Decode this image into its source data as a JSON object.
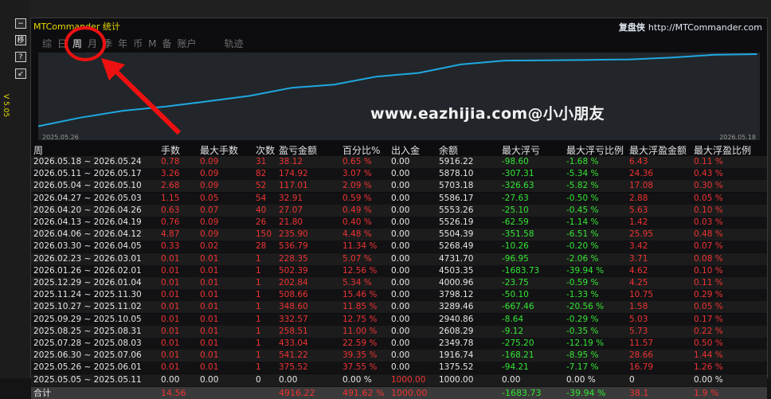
{
  "side": {
    "buttons": [
      "−",
      "移",
      "?",
      "↙"
    ],
    "version": "V 5.05"
  },
  "header": {
    "title": "MTCommander 统计",
    "brand_cn": "复盘侠",
    "brand_url": "http://MTCommander.com",
    "tabs": [
      {
        "label": "综",
        "active": false
      },
      {
        "label": "日",
        "active": false
      },
      {
        "label": "周",
        "active": true
      },
      {
        "label": "月",
        "active": false
      },
      {
        "label": "季",
        "active": false
      },
      {
        "label": "年",
        "active": false
      },
      {
        "label": "币",
        "active": false
      },
      {
        "label": "M",
        "active": false
      },
      {
        "label": "备",
        "active": false
      },
      {
        "label": "账户",
        "active": false
      },
      {
        "label": "轨迹",
        "active": false
      }
    ]
  },
  "chart": {
    "start_date": "2025.05.26",
    "end_date": "2026.05.18",
    "line_color": "#1fa8e0",
    "balance_series": [
      1375.52,
      1916.74,
      2349.78,
      2608.29,
      2940.86,
      3289.46,
      3798.12,
      4000.96,
      4503.35,
      4731.7,
      5268.49,
      5504.39,
      5526.19,
      5553.26,
      5586.17,
      5703.18,
      5878.1,
      5916.22
    ]
  },
  "watermark": "www.eazhijia.com@小小朋友",
  "table": {
    "headers": [
      "周",
      "手数",
      "最大手数",
      "次数",
      "盈亏金额",
      "百分比%",
      "出入金",
      "余额",
      "最大浮亏",
      "最大浮亏比例",
      "最大浮盈金额",
      "最大浮盈比例"
    ],
    "rows": [
      [
        "2026.05.18 ~ 2026.05.24",
        "0.78",
        "0.09",
        "31",
        "38.12",
        "0.65 %",
        "0.00",
        "5916.22",
        "-98.60",
        "-1.68 %",
        "6.43",
        "0.11 %"
      ],
      [
        "2026.05.11 ~ 2026.05.17",
        "3.26",
        "0.09",
        "82",
        "174.92",
        "3.07 %",
        "0.00",
        "5878.10",
        "-307.31",
        "-5.34 %",
        "24.36",
        "0.43 %"
      ],
      [
        "2026.05.04 ~ 2026.05.10",
        "2.68",
        "0.09",
        "52",
        "117.01",
        "2.09 %",
        "0.00",
        "5703.18",
        "-326.63",
        "-5.82 %",
        "17.08",
        "0.30 %"
      ],
      [
        "2026.04.27 ~ 2026.05.03",
        "1.15",
        "0.05",
        "54",
        "32.91",
        "0.59 %",
        "0.00",
        "5586.17",
        "-27.63",
        "-0.50 %",
        "2.88",
        "0.05 %"
      ],
      [
        "2026.04.20 ~ 2026.04.26",
        "0.63",
        "0.07",
        "40",
        "27.07",
        "0.49 %",
        "0.00",
        "5553.26",
        "-25.10",
        "-0.45 %",
        "5.63",
        "0.10 %"
      ],
      [
        "2026.04.13 ~ 2026.04.19",
        "0.76",
        "0.09",
        "26",
        "21.80",
        "0.40 %",
        "0.00",
        "5526.19",
        "-62.59",
        "-1.14 %",
        "1.42",
        "0.03 %"
      ],
      [
        "2026.04.06 ~ 2026.04.12",
        "4.87",
        "0.09",
        "150",
        "235.90",
        "4.48 %",
        "0.00",
        "5504.39",
        "-351.58",
        "-6.51 %",
        "25.95",
        "0.48 %"
      ],
      [
        "2026.03.30 ~ 2026.04.05",
        "0.33",
        "0.02",
        "28",
        "536.79",
        "11.34 %",
        "0.00",
        "5268.49",
        "-10.26",
        "-0.20 %",
        "3.42",
        "0.07 %"
      ],
      [
        "2026.02.23 ~ 2026.03.01",
        "0.01",
        "0.01",
        "1",
        "228.35",
        "5.07 %",
        "0.00",
        "4731.70",
        "-96.95",
        "-2.06 %",
        "3.71",
        "0.08 %"
      ],
      [
        "2026.01.26 ~ 2026.02.01",
        "0.01",
        "0.01",
        "1",
        "502.39",
        "12.56 %",
        "0.00",
        "4503.35",
        "-1683.73",
        "-39.94 %",
        "4.62",
        "0.10 %"
      ],
      [
        "2025.12.29 ~ 2026.01.04",
        "0.01",
        "0.01",
        "1",
        "202.84",
        "5.34 %",
        "0.00",
        "4000.96",
        "-23.75",
        "-0.59 %",
        "4.25",
        "0.11 %"
      ],
      [
        "2025.11.24 ~ 2025.11.30",
        "0.01",
        "0.01",
        "1",
        "508.66",
        "15.46 %",
        "0.00",
        "3798.12",
        "-50.10",
        "-1.33 %",
        "10.75",
        "0.29 %"
      ],
      [
        "2025.10.27 ~ 2025.11.02",
        "0.01",
        "0.01",
        "1",
        "348.60",
        "11.85 %",
        "0.00",
        "3289.46",
        "-667.46",
        "-20.56 %",
        "1.58",
        "0.05 %"
      ],
      [
        "2025.09.29 ~ 2025.10.05",
        "0.01",
        "0.01",
        "1",
        "332.57",
        "12.75 %",
        "0.00",
        "2940.86",
        "-8.64",
        "-0.29 %",
        "5.03",
        "0.17 %"
      ],
      [
        "2025.08.25 ~ 2025.08.31",
        "0.01",
        "0.01",
        "1",
        "258.51",
        "11.00 %",
        "0.00",
        "2608.29",
        "-9.12",
        "-0.35 %",
        "5.73",
        "0.22 %"
      ],
      [
        "2025.07.28 ~ 2025.08.03",
        "0.01",
        "0.01",
        "1",
        "433.04",
        "22.59 %",
        "0.00",
        "2349.78",
        "-275.20",
        "-12.19 %",
        "11.57",
        "0.50 %"
      ],
      [
        "2025.06.30 ~ 2025.07.06",
        "0.01",
        "0.01",
        "1",
        "541.22",
        "39.35 %",
        "0.00",
        "1916.74",
        "-168.21",
        "-8.95 %",
        "28.66",
        "1.44 %"
      ],
      [
        "2025.05.26 ~ 2025.06.01",
        "0.01",
        "0.01",
        "1",
        "375.52",
        "37.55 %",
        "0.00",
        "1375.52",
        "-94.21",
        "-7.17 %",
        "16.79",
        "1.26 %"
      ],
      [
        "2025.05.05 ~ 2025.05.11",
        "0.00",
        "0.00",
        "0",
        "0.00",
        "0.00 %",
        "1000.00",
        "1000.00",
        "0.00",
        "0.00 %",
        "0",
        "0.00 %"
      ]
    ],
    "total": [
      "合计",
      "14.56",
      "",
      "",
      "4916.22",
      "491.62 %",
      "1000.00",
      "",
      "-1683.73",
      "-39.94 %",
      "38.1",
      "1.9 %"
    ]
  }
}
